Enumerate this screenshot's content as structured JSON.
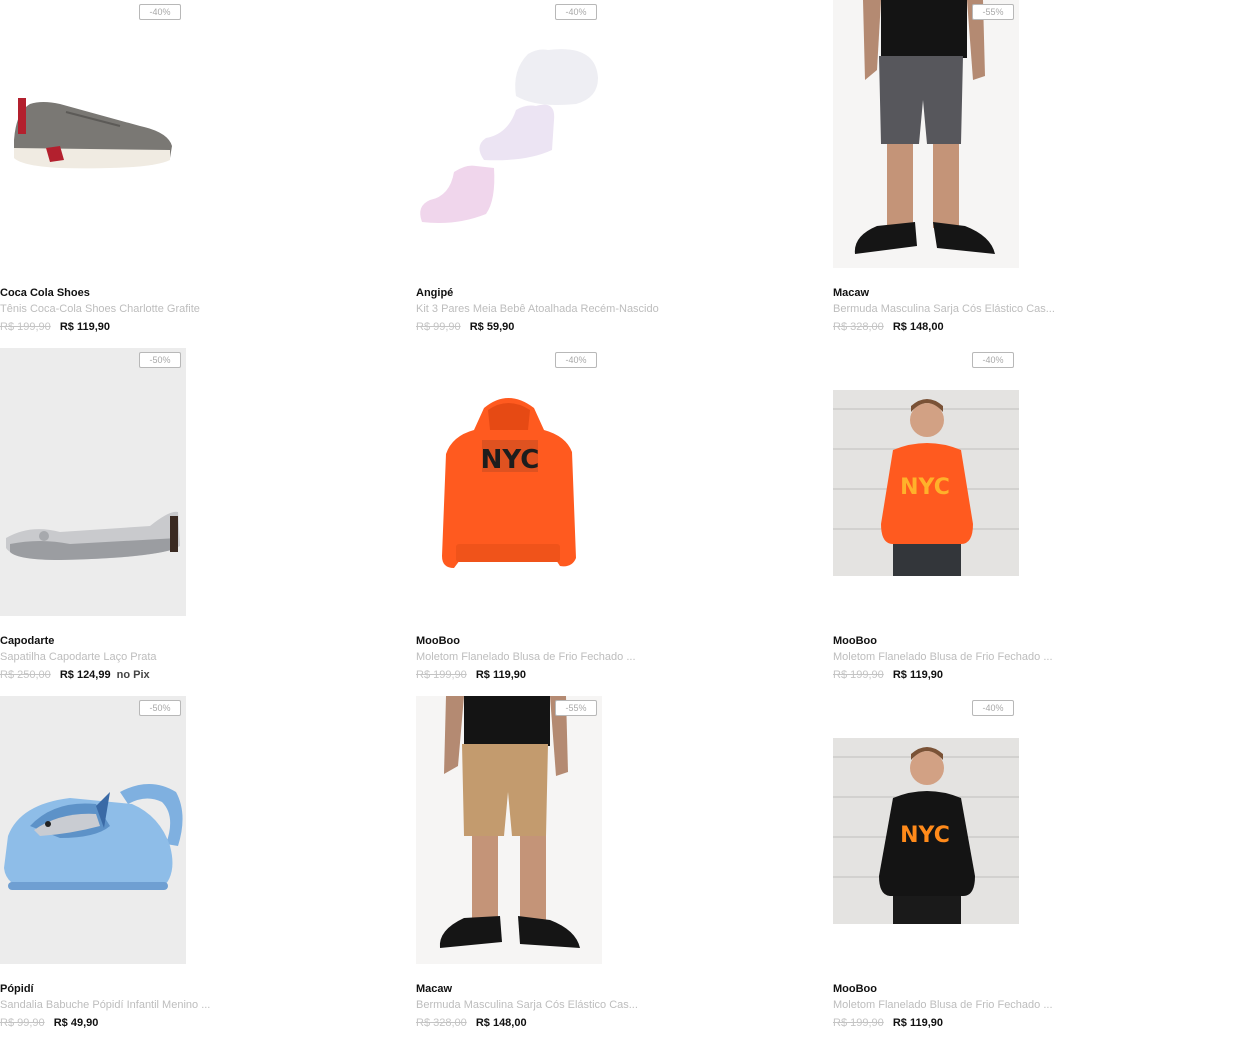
{
  "products": [
    {
      "badge": "-40%",
      "brand": "Coca Cola Shoes",
      "title": "Tênis Coca-Cola Shoes Charlotte Grafite",
      "old_price": "R$ 199,90",
      "price": "R$ 119,90",
      "price_suffix": "",
      "image": "grey-sneaker"
    },
    {
      "badge": "-40%",
      "brand": "Angipé",
      "title": "Kit 3 Pares Meia Bebê Atoalhada Recém-Nascido",
      "old_price": "R$ 99,90",
      "price": "R$ 59,90",
      "price_suffix": "",
      "image": "baby-socks"
    },
    {
      "badge": "-55%",
      "brand": "Macaw",
      "title": "Bermuda Masculina Sarja Cós Elástico Cas...",
      "old_price": "R$ 328,00",
      "price": "R$ 148,00",
      "price_suffix": "",
      "image": "grey-shorts-model"
    },
    {
      "badge": "-50%",
      "brand": "Capodarte",
      "title": "Sapatilha Capodarte Laço Prata",
      "old_price": "R$ 250,00",
      "price": "R$ 124,99",
      "price_suffix": "no Pix",
      "image": "silver-flat"
    },
    {
      "badge": "-40%",
      "brand": "MooBoo",
      "title": "Moletom Flanelado Blusa de Frio Fechado ...",
      "old_price": "R$ 199,90",
      "price": "R$ 119,90",
      "price_suffix": "",
      "image": "orange-hoodie"
    },
    {
      "badge": "-40%",
      "brand": "MooBoo",
      "title": "Moletom Flanelado Blusa de Frio Fechado ...",
      "old_price": "R$ 199,90",
      "price": "R$ 119,90",
      "price_suffix": "",
      "image": "orange-hoodie-model"
    },
    {
      "badge": "-50%",
      "brand": "Pópidí",
      "title": "Sandalia Babuche Pópidí Infantil Menino ...",
      "old_price": "R$ 99,90",
      "price": "R$ 49,90",
      "price_suffix": "",
      "image": "blue-clog"
    },
    {
      "badge": "-55%",
      "brand": "Macaw",
      "title": "Bermuda Masculina Sarja Cós Elástico Cas...",
      "old_price": "R$ 328,00",
      "price": "R$ 148,00",
      "price_suffix": "",
      "image": "khaki-shorts-model"
    },
    {
      "badge": "-40%",
      "brand": "MooBoo",
      "title": "Moletom Flanelado Blusa de Frio Fechado ...",
      "old_price": "R$ 199,90",
      "price": "R$ 119,90",
      "price_suffix": "",
      "image": "black-hoodie-model"
    }
  ],
  "print_text": "NYC",
  "colors": {
    "hoodie_orange": "#ff5a1f",
    "text_dark": "#111111",
    "text_muted": "#bdbdbd",
    "badge_border": "#b8b8b8"
  }
}
